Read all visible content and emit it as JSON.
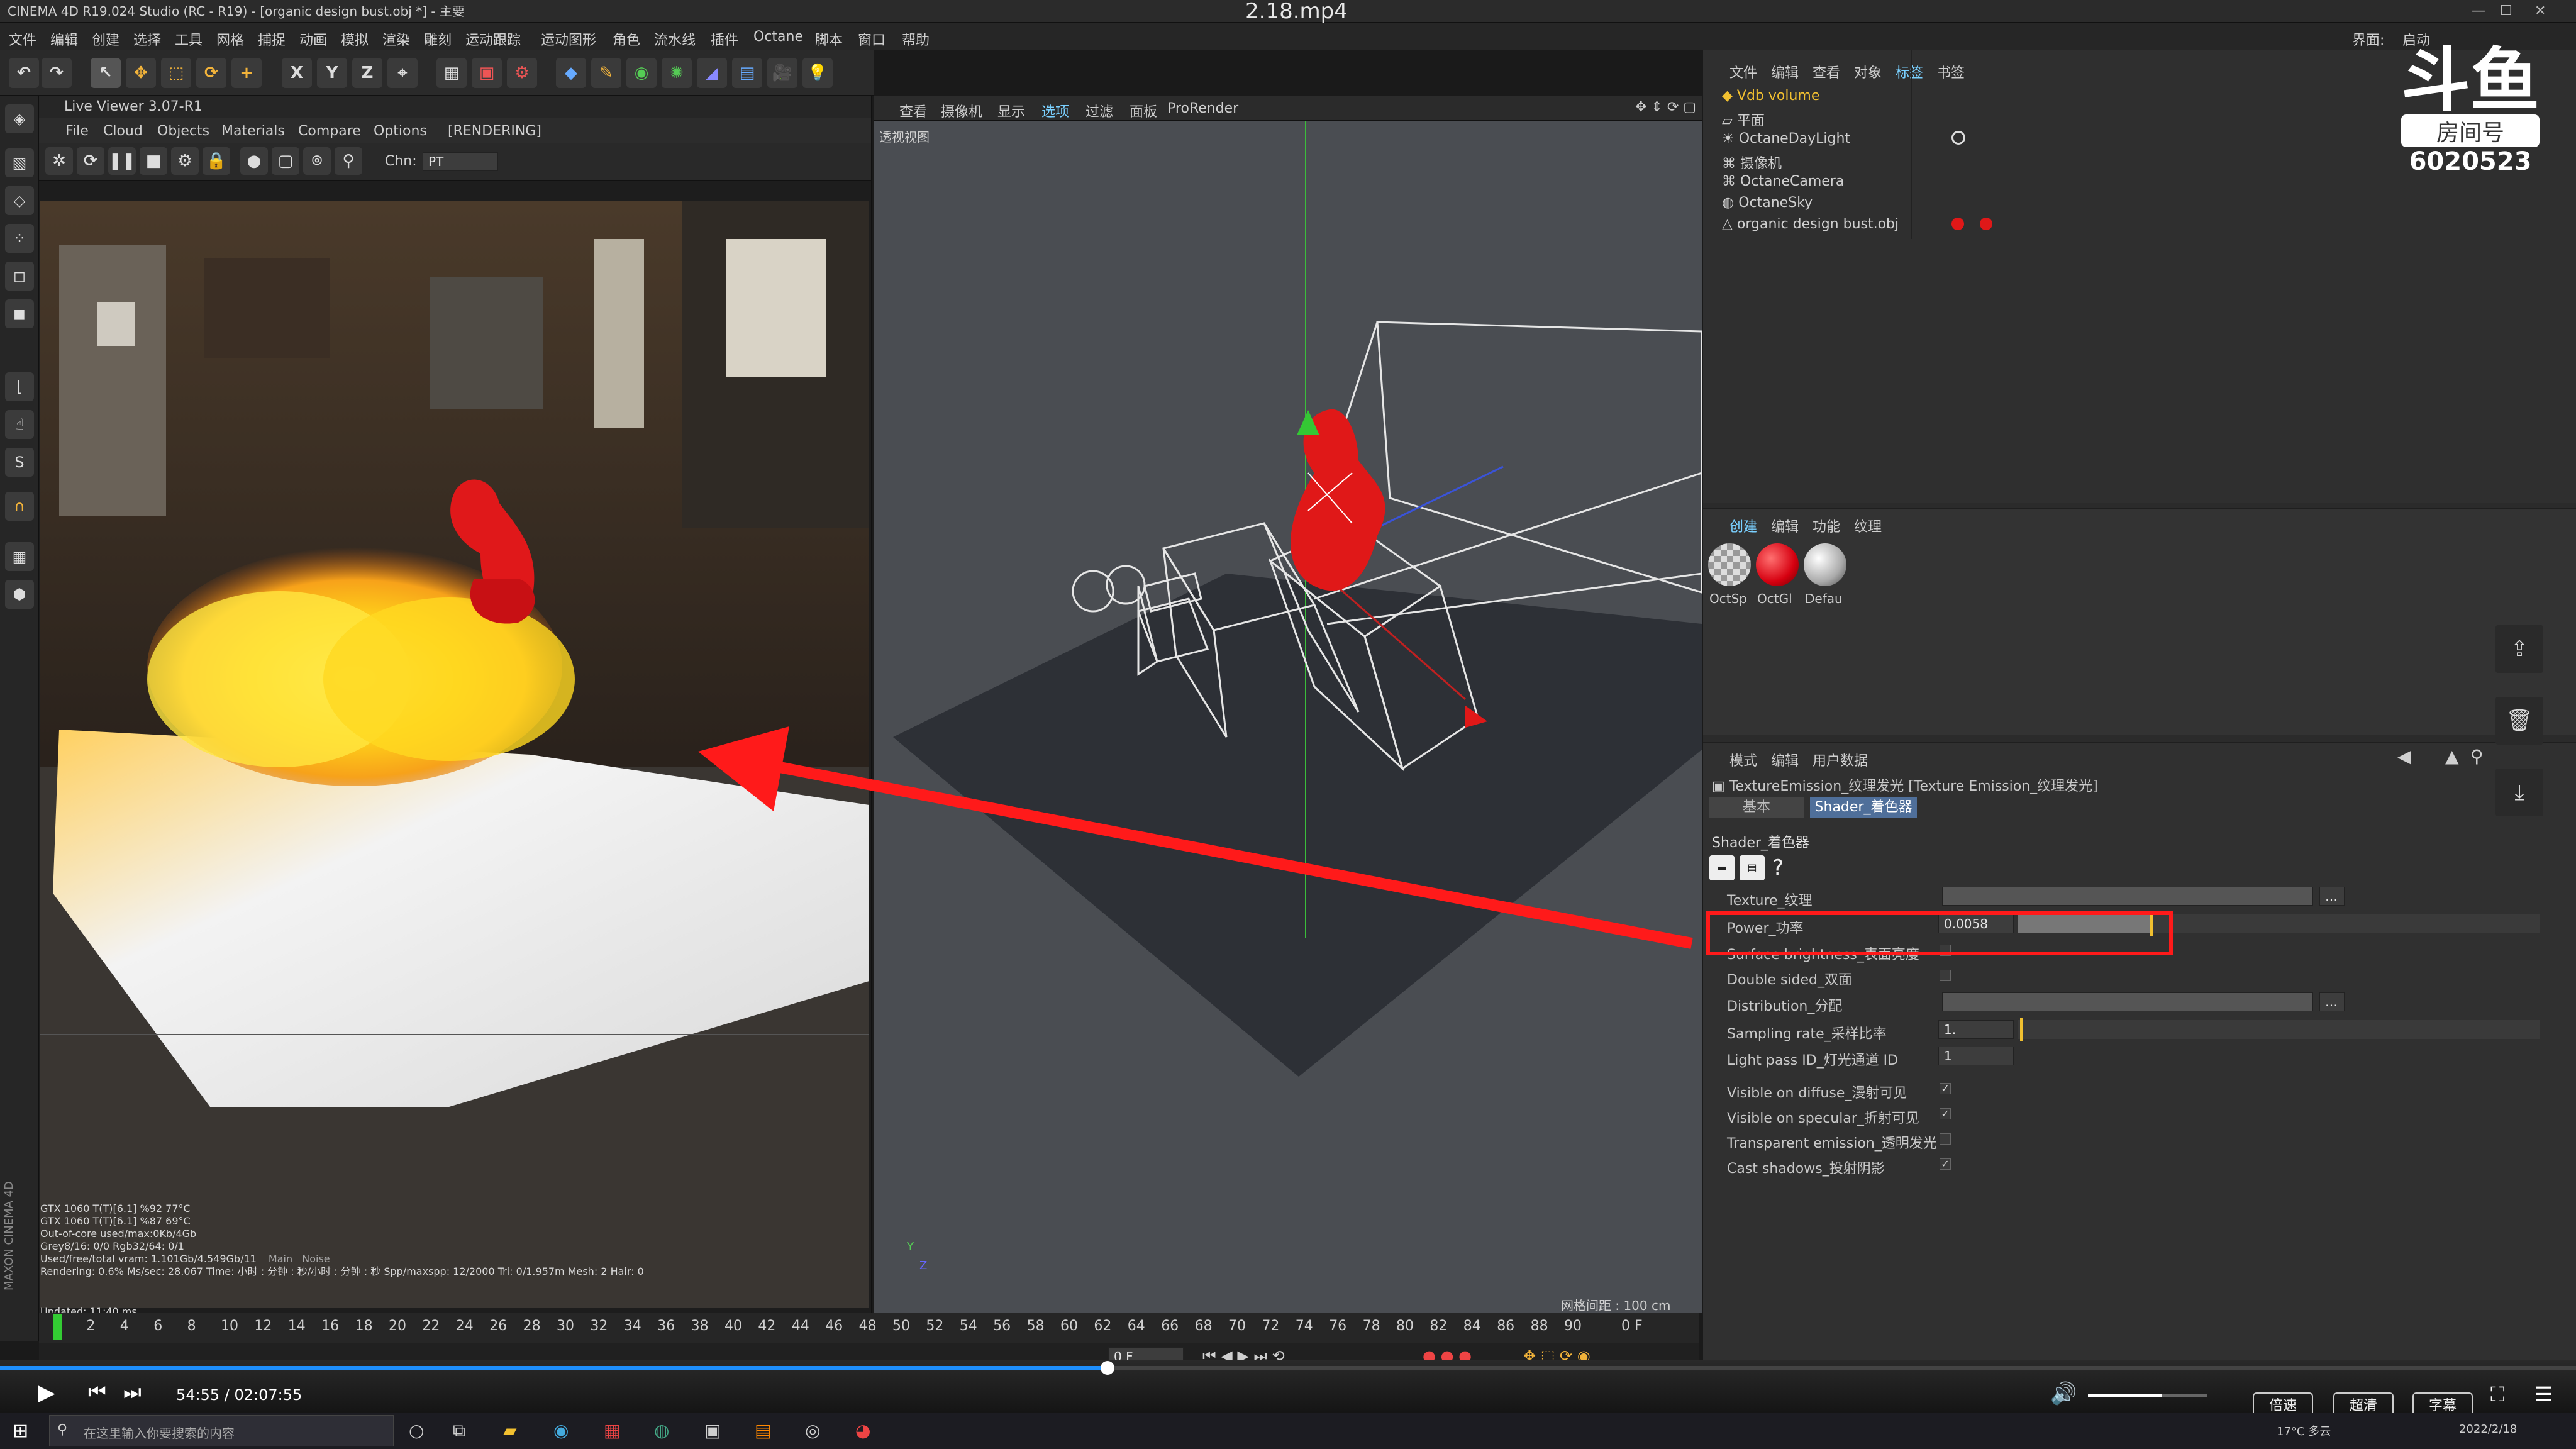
{
  "titlebar": {
    "app_title": "CINEMA 4D R19.024 Studio (RC - R19) - [organic design bust.obj *] - 主要",
    "video_title": "2.18.mp4",
    "layout_label": "界面:",
    "layout_value": "启动"
  },
  "menu": [
    "文件",
    "编辑",
    "创建",
    "选择",
    "工具",
    "网格",
    "捕捉",
    "动画",
    "模拟",
    "渲染",
    "雕刻",
    "运动跟踪",
    "运动图形",
    "角色",
    "流水线",
    "插件",
    "Octane",
    "脚本",
    "窗口",
    "帮助"
  ],
  "toolbar": {
    "axis_x": "X",
    "axis_y": "Y",
    "axis_z": "Z"
  },
  "live_viewer": {
    "title": "Live Viewer 3.07-R1",
    "menu": [
      "File",
      "Cloud",
      "Objects",
      "Materials",
      "Compare",
      "Options"
    ],
    "status": "[RENDERING]",
    "chn_label": "Chn:",
    "chn_value": "PT",
    "stats": [
      "GTX 1060 T(T)[6.1]   %92   77°C",
      "GTX 1060 T(T)[6.1]   %87   69°C",
      "Out-of-core used/max:0Kb/4Gb",
      "Grey8/16: 0/0          Rgb32/64: 0/1",
      "Used/free/total vram: 1.101Gb/4.549Gb/11",
      "Rendering: 0.6%   Ms/sec: 28.067   Time: 小时 : 分钟 : 秒/小时 : 分钟 : 秒   Spp/maxspp: 12/2000   Tri: 0/1.957m  Mesh: 2   Hair: 0",
      "Updated: 11:40 ms"
    ],
    "stat_tabs": [
      "Main",
      "Noise"
    ]
  },
  "viewport": {
    "menu": [
      "查看",
      "摄像机",
      "显示",
      "选项",
      "过滤",
      "面板",
      "ProRender"
    ],
    "label": "透视视图",
    "grid_spacing": "网格间距 : 100 cm",
    "axis_y": "Y",
    "axis_z": "Z"
  },
  "objects": {
    "menu": [
      "文件",
      "编辑",
      "查看",
      "对象",
      "标签",
      "书签"
    ],
    "items": [
      "Vdb volume",
      "平面",
      "OctaneDayLight",
      "摄像机",
      "OctaneCamera",
      "OctaneSky",
      "organic design bust.obj"
    ]
  },
  "watermark": {
    "room_label": "房间号",
    "room_number": "6020523"
  },
  "materials": {
    "menu": [
      "创建",
      "编辑",
      "功能",
      "纹理"
    ],
    "items": [
      "OctSp",
      "OctGl",
      "Defau"
    ]
  },
  "attributes": {
    "menu": [
      "模式",
      "编辑",
      "用户数据"
    ],
    "title": "TextureEmission_纹理发光 [Texture Emission_纹理发光]",
    "tabs": [
      "基本",
      "Shader_着色器"
    ],
    "section": "Shader_着色器",
    "rows": {
      "texture": "Texture_纹理",
      "power": "Power_功率",
      "power_value": "0.0058",
      "surface_brightness": "Surface brightness_表面亮度",
      "double_sided": "Double sided_双面",
      "distribution": "Distribution_分配",
      "sampling_rate": "Sampling rate_采样比率",
      "sampling_rate_value": "1.",
      "light_pass_id": "Light pass ID_灯光通道 ID",
      "light_pass_id_value": "1",
      "visible_diffuse": "Visible on diffuse_漫射可见",
      "visible_specular": "Visible on specular_折射可见",
      "transparent_emission": "Transparent emission_透明发光",
      "cast_shadows": "Cast shadows_投射阴影"
    }
  },
  "timeline": {
    "ticks": [
      "0",
      "2",
      "4",
      "6",
      "8",
      "10",
      "12",
      "14",
      "16",
      "18",
      "20",
      "22",
      "24",
      "26",
      "28",
      "30",
      "32",
      "34",
      "36",
      "38",
      "40",
      "42",
      "44",
      "46",
      "48",
      "50",
      "52",
      "54",
      "56",
      "58",
      "60",
      "62",
      "64",
      "66",
      "68",
      "70",
      "72",
      "74",
      "76",
      "78",
      "80",
      "82",
      "84",
      "86",
      "88",
      "90"
    ],
    "current_frame": "0 F",
    "frame_field": "0 F"
  },
  "player": {
    "time": "54:55 / 02:07:55",
    "progress_fraction": 0.43,
    "volume_fraction": 0.62,
    "buttons": [
      "倍速",
      "超清",
      "字幕"
    ]
  },
  "taskbar": {
    "search_placeholder": "在这里输入你要搜索的内容",
    "weather": "17°C 多云",
    "date": "2022/2/18"
  },
  "colors": {
    "accent_red": "#ff1a1a",
    "highlight_yellow": "#f0c030"
  }
}
